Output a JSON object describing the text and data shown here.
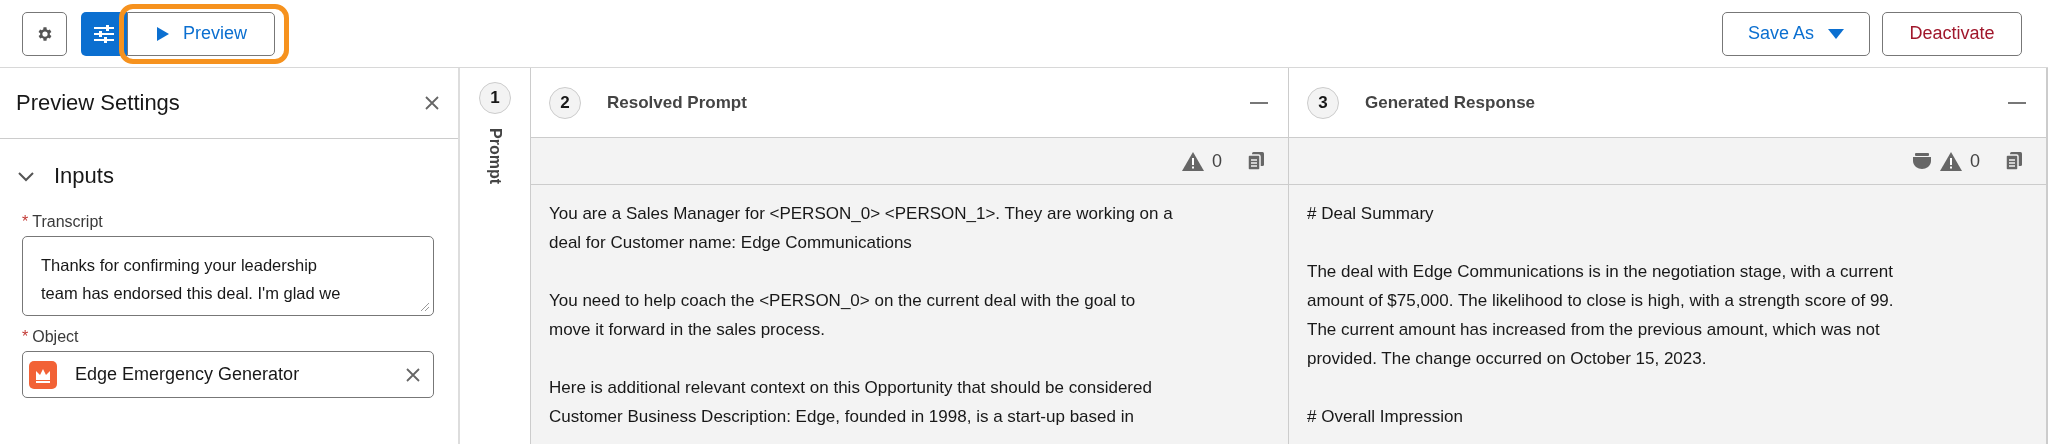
{
  "toolbar": {
    "preview": {
      "label": "Preview",
      "highlighted": true
    },
    "save_as": {
      "label": "Save As"
    },
    "deactivate": {
      "label": "Deactivate"
    }
  },
  "preview_settings": {
    "title": "Preview Settings",
    "section": {
      "title": "Inputs",
      "expanded": true
    },
    "fields": [
      {
        "kind": "textarea",
        "label": "Transcript",
        "required_mark": "*",
        "lines": [
          "Thanks for confirming your leadership",
          "team has endorsed this deal. I'm glad we"
        ]
      },
      {
        "kind": "lookup",
        "label": "Object",
        "required_mark": "*",
        "value": "Edge Emergency Generator"
      }
    ]
  },
  "steps": [
    {
      "kind": "rail",
      "number": "1",
      "title": "Prompt"
    },
    {
      "kind": "panel",
      "number": "2",
      "title": "Resolved Prompt",
      "trust_badge": false,
      "warnings": "0",
      "paragraphs": [
        [
          "You are a Sales Manager for <PERSON_0> <PERSON_1>. They are working on a",
          "deal for Customer name: Edge Communications"
        ],
        [
          "You need to help coach the <PERSON_0> on the current deal with the goal to",
          "move it forward in the sales process."
        ],
        [
          "Here is additional relevant context on this Opportunity that should be considered",
          "Customer Business Description: Edge, founded in 1998, is a start-up based in"
        ]
      ]
    },
    {
      "kind": "panel",
      "number": "3",
      "title": "Generated Response",
      "trust_badge": true,
      "warnings": "0",
      "paragraphs": [
        [
          "# Deal Summary"
        ],
        [
          "The deal with Edge Communications is in the negotiation stage, with a current",
          "amount of $75,000. The likelihood to close is high, with a strength score of 99.",
          "The current amount has increased from the previous amount, which was not",
          "provided. The change occurred on October 15, 2023."
        ],
        [
          "# Overall Impression"
        ]
      ]
    }
  ]
}
